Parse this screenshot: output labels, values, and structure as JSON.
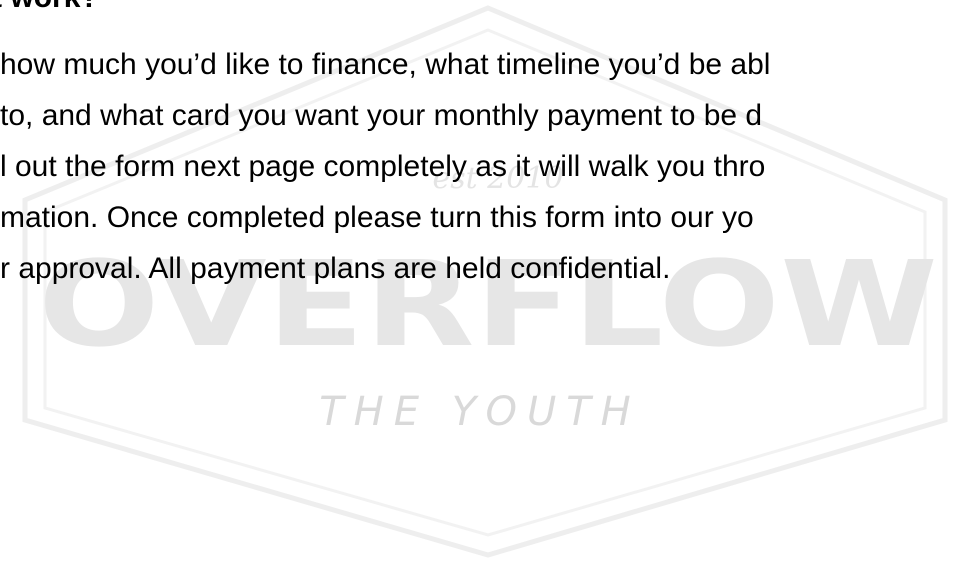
{
  "document": {
    "heading": "es it work?",
    "body_lines": [
      "how much you’d like to finance, what timeline you’d be abl",
      "to, and what card you want your monthly payment to be d",
      "l out the form next page completely as it will walk you thro",
      "mation.  Once completed please turn this form into our yo",
      "r approval.  All payment plans are held confidential."
    ]
  },
  "watermark": {
    "logo_est": "est 2010",
    "logo_name": "OVERFLOW",
    "logo_tagline": "THE YOUTH",
    "color": "#e6e6e6"
  }
}
